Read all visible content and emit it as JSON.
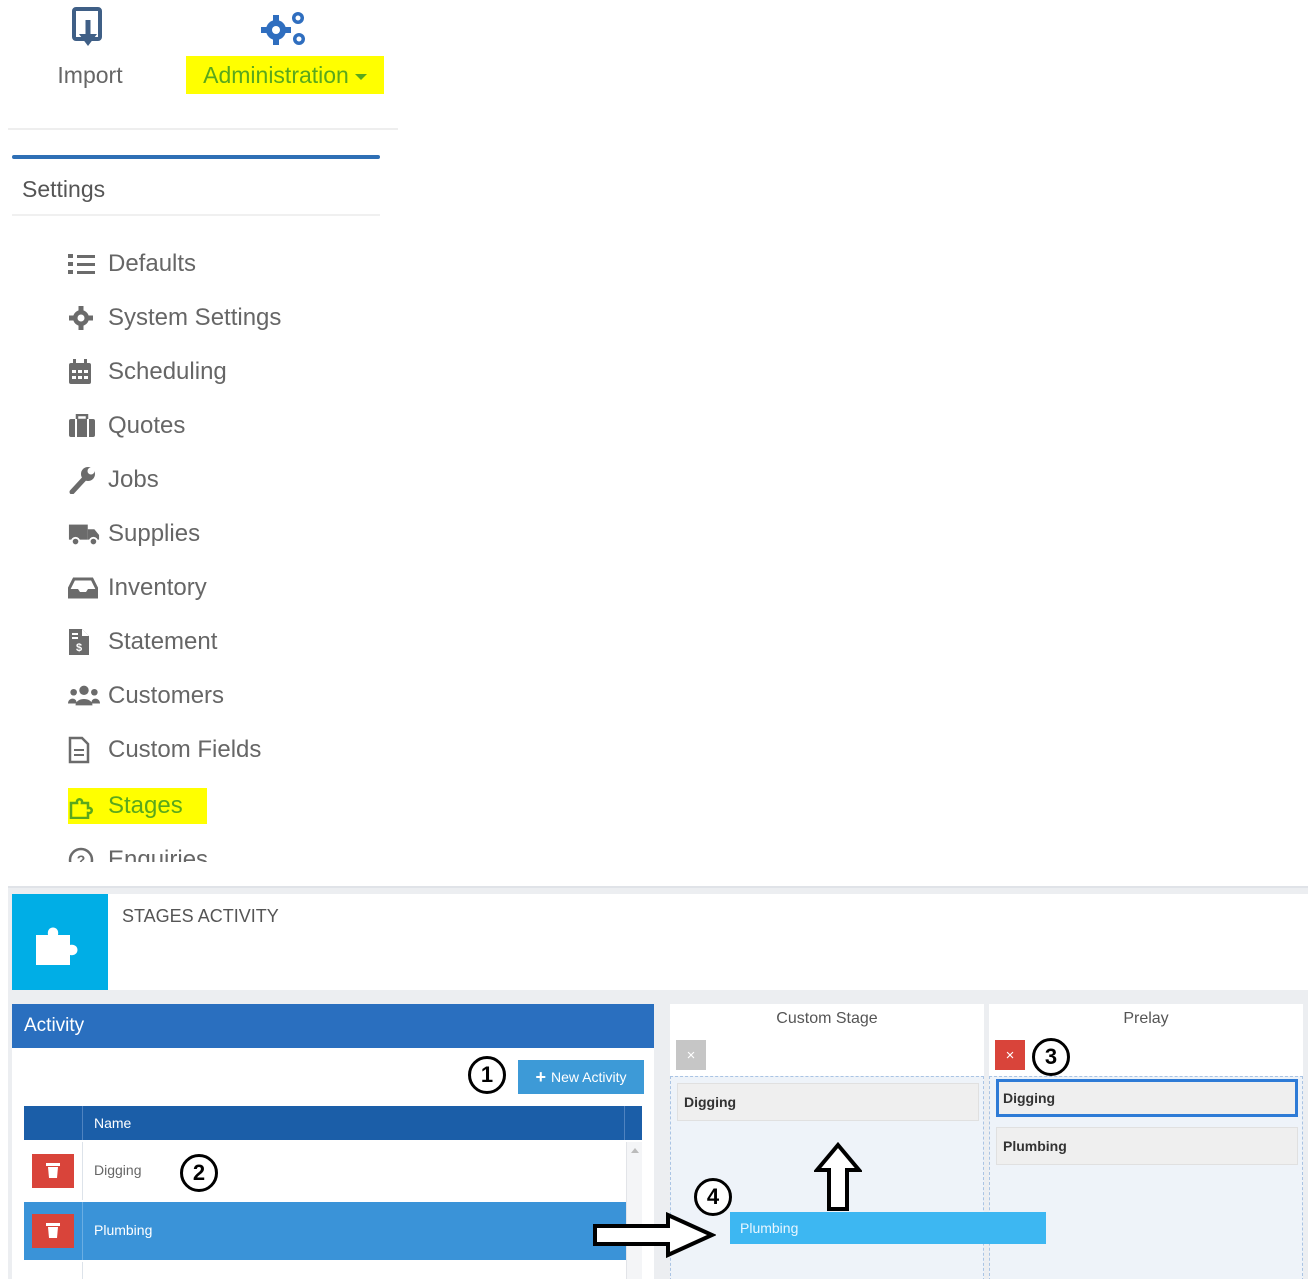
{
  "toolbar": {
    "import_label": "Import",
    "import_icon": "import-icon",
    "admin_label": "Administration",
    "admin_icon": "cogs-icon",
    "highlight_color": "#ffff00",
    "admin_text_color": "#5aa81c"
  },
  "settings": {
    "title": "Settings",
    "items": [
      {
        "label": "Defaults",
        "icon": "list-check-icon"
      },
      {
        "label": "System Settings",
        "icon": "gear-icon"
      },
      {
        "label": "Scheduling",
        "icon": "calendar-icon"
      },
      {
        "label": "Quotes",
        "icon": "briefcase-icon"
      },
      {
        "label": "Jobs",
        "icon": "wrench-icon"
      },
      {
        "label": "Supplies",
        "icon": "truck-icon"
      },
      {
        "label": "Inventory",
        "icon": "inbox-icon"
      },
      {
        "label": "Statement",
        "icon": "file-invoice-icon"
      },
      {
        "label": "Customers",
        "icon": "users-icon"
      },
      {
        "label": "Custom Fields",
        "icon": "file-icon"
      },
      {
        "label": "Stages",
        "icon": "puzzle-icon",
        "active": true
      },
      {
        "label": "Enquiries",
        "icon": "question-circle-icon"
      }
    ]
  },
  "stages": {
    "title": "STAGES ACTIVITY",
    "header_icon": "puzzle-icon",
    "accent_color": "#00aee6",
    "activity": {
      "heading": "Activity",
      "new_button": "New Activity",
      "column_name": "Name",
      "rows": [
        {
          "name": "Digging",
          "selected": false
        },
        {
          "name": "Plumbing",
          "selected": true
        }
      ]
    },
    "columns": [
      {
        "title": "Custom Stage",
        "remove_enabled": false,
        "items": [
          "Digging"
        ]
      },
      {
        "title": "Prelay",
        "remove_enabled": true,
        "items": [
          "Digging",
          "Plumbing"
        ]
      }
    ],
    "drag_ghost": "Plumbing",
    "remove_symbol": "×"
  },
  "annotations": {
    "m1": "1",
    "m2": "2",
    "m3": "3",
    "m4": "4"
  }
}
